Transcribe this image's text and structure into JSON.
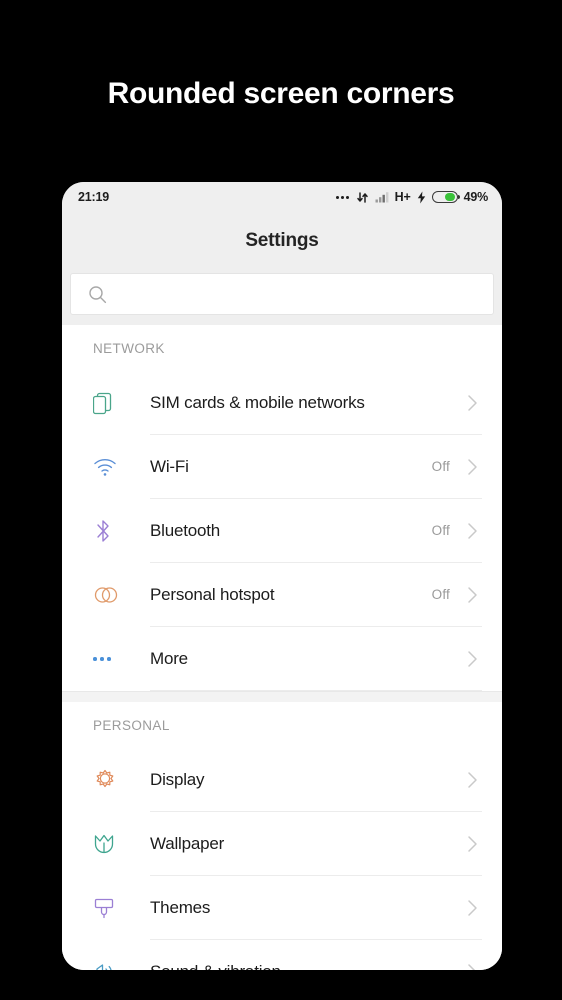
{
  "headline": "Rounded screen corners",
  "phone": {
    "status_bar": {
      "time": "21:19",
      "icons": [
        "more-dots-icon",
        "data-transfer-icon",
        "signal-bars-icon"
      ],
      "network_type": "H+",
      "charging": "charging-bolt-icon",
      "battery_percent": "49%",
      "battery_level": 49,
      "battery_color": "#3ac23a"
    },
    "toolbar": {
      "title": "Settings"
    },
    "search": {
      "value": "",
      "placeholder": "",
      "icon": "search-icon"
    },
    "sections": [
      {
        "header": "NETWORK",
        "items": [
          {
            "label": "SIM cards & mobile networks",
            "value": "",
            "icon": "sim-cards-icon",
            "icon_color": "#4aa58a"
          },
          {
            "label": "Wi-Fi",
            "value": "Off",
            "icon": "wifi-icon",
            "icon_color": "#5b8fd6"
          },
          {
            "label": "Bluetooth",
            "value": "Off",
            "icon": "bluetooth-icon",
            "icon_color": "#9b7fd4"
          },
          {
            "label": "Personal hotspot",
            "value": "Off",
            "icon": "hotspot-icon",
            "icon_color": "#e09a6a"
          },
          {
            "label": "More",
            "value": "",
            "icon": "more-dots-icon",
            "icon_color": "#4a90d9"
          }
        ]
      },
      {
        "header": "PERSONAL",
        "items": [
          {
            "label": "Display",
            "value": "",
            "icon": "sun-display-icon",
            "icon_color": "#e08a5a"
          },
          {
            "label": "Wallpaper",
            "value": "",
            "icon": "tulip-wallpaper-icon",
            "icon_color": "#3fa58f"
          },
          {
            "label": "Themes",
            "value": "",
            "icon": "paint-brush-icon",
            "icon_color": "#9b7fd4"
          },
          {
            "label": "Sound & vibration",
            "value": "",
            "icon": "speaker-icon",
            "icon_color": "#4a9bc4"
          }
        ]
      }
    ]
  }
}
